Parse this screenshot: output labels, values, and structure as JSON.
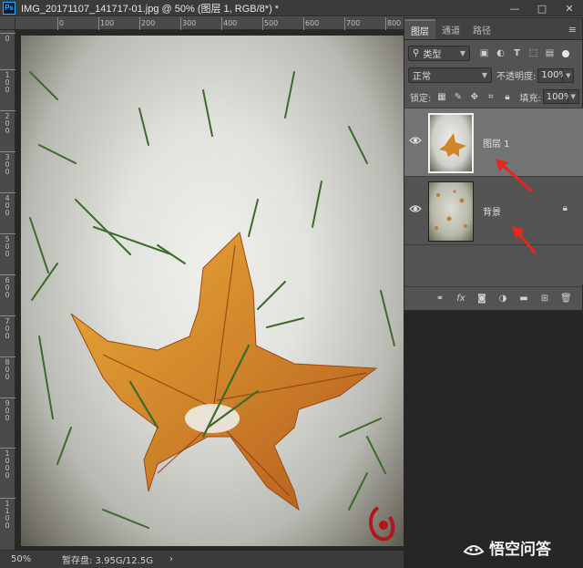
{
  "window": {
    "app_logo": "Ps",
    "doc_title": "IMG_20171107_141717-01.jpg @ 50% (图层 1, RGB/8*) *",
    "minimize": "—",
    "maximize": "□",
    "close": "✕"
  },
  "rulers": {
    "top": [
      "0",
      "100",
      "200",
      "300",
      "400",
      "500",
      "600",
      "700",
      "800"
    ],
    "left": [
      "0",
      "100",
      "200",
      "300",
      "400",
      "500",
      "600",
      "700",
      "800",
      "900",
      "1000",
      "1100"
    ]
  },
  "status": {
    "zoom": "50%",
    "scratch": "暂存盘: 3.95G/12.5G",
    "arrow": "›"
  },
  "panel": {
    "close": "«",
    "menu": "≡",
    "tabs": [
      {
        "label": "图层"
      },
      {
        "label": "通道"
      },
      {
        "label": "路径"
      }
    ],
    "filter_kind": "类型",
    "filter_icons": [
      "image-filter-icon",
      "adjustment-filter-icon",
      "type-filter-icon",
      "shape-filter-icon",
      "smart-object-filter-icon"
    ],
    "blend_mode": "正常",
    "opacity_label": "不透明度:",
    "opacity_value": "100%",
    "lock_label": "锁定:",
    "fill_label": "填充:",
    "fill_value": "100%",
    "layers": [
      {
        "name": "图层 1",
        "selected": true,
        "locked": false
      },
      {
        "name": "背景",
        "selected": false,
        "locked": true
      }
    ],
    "footer_icons": [
      "link-layers-icon",
      "fx-icon",
      "add-mask-icon",
      "adjustment-layer-icon",
      "new-group-icon",
      "new-layer-icon",
      "delete-icon"
    ],
    "fx_label": "fx"
  },
  "watermark": {
    "text": "悟空问答"
  },
  "colors": {
    "annotation_arrow": "#e8261e",
    "leaf": "#d88a25"
  }
}
